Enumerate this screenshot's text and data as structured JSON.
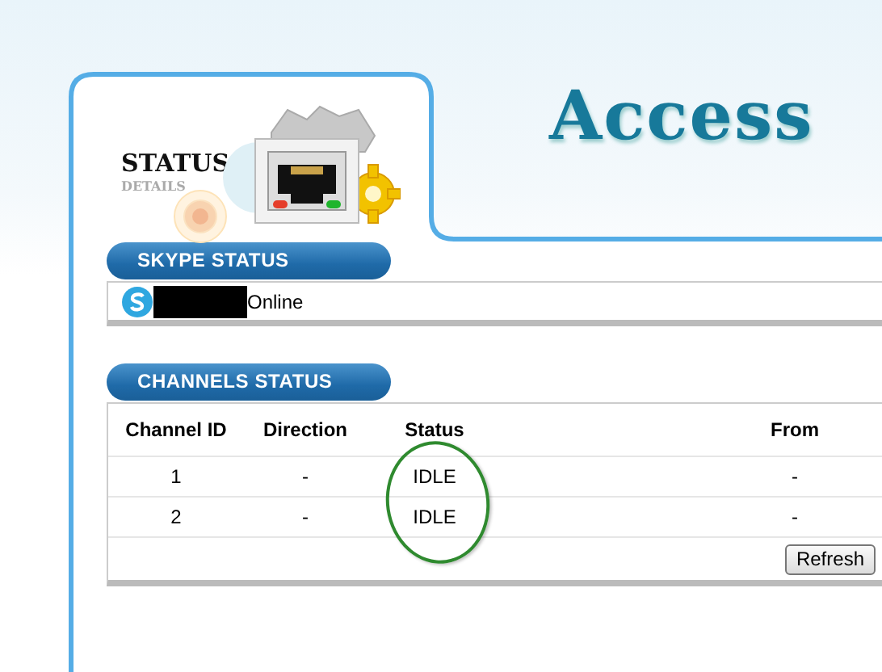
{
  "header": {
    "title": "STATUS",
    "subtitle": "DETAILS",
    "logo": "Access"
  },
  "skype_status": {
    "heading": "SKYPE STATUS",
    "status": "Online"
  },
  "channels_status": {
    "heading": "CHANNELS STATUS",
    "columns": [
      "Channel ID",
      "Direction",
      "Status",
      "From"
    ],
    "rows": [
      [
        "1",
        "-",
        "IDLE",
        "-"
      ],
      [
        "2",
        "-",
        "IDLE",
        "-"
      ]
    ],
    "refresh_button": "Refresh"
  }
}
